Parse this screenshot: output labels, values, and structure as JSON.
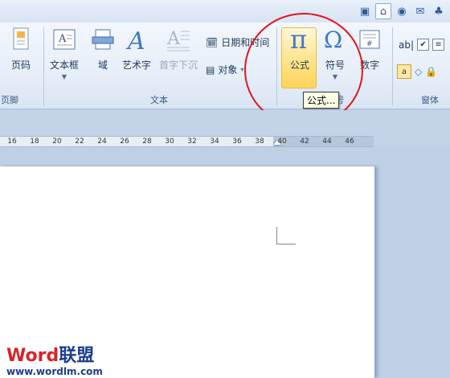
{
  "quick_icons": [
    "window-icon",
    "home-icon",
    "globe-icon",
    "mail-icon",
    "tree-icon"
  ],
  "ribbon": {
    "buttons": {
      "page_code": "页码",
      "text_box": "文本框",
      "field": "域",
      "wordart": "艺术字",
      "drop_cap": "首字下沉",
      "date_time": "日期和时间",
      "object": "对象",
      "equation": "公式",
      "symbol": "符号",
      "number": "数字"
    },
    "groups": {
      "header_footer_tail": "页脚",
      "text": "文本",
      "symbols_tail": "号",
      "form": "窗体"
    },
    "form_controls": {
      "text_field": "ab|"
    }
  },
  "tooltip": {
    "text": "公式..."
  },
  "ruler": {
    "ticks": [
      "16",
      "18",
      "20",
      "22",
      "24",
      "26",
      "28",
      "30",
      "32",
      "34",
      "36",
      "38",
      "40",
      "42",
      "44",
      "46"
    ]
  },
  "watermark": {
    "brand_latin": "Word",
    "brand_cn": "联盟",
    "url": "www.wordlm.com"
  },
  "colors": {
    "annotation_circle": "#e4141b",
    "hover_gold": "#ffe48a",
    "ribbon_text": "#1e395b"
  }
}
